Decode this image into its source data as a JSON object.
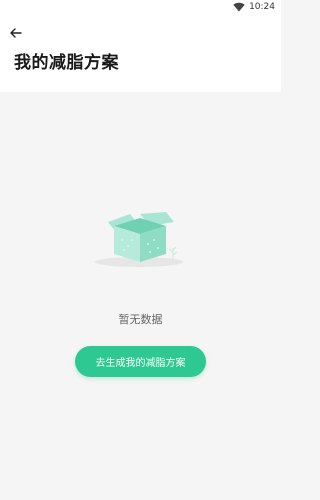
{
  "status_bar": {
    "time": "10:24",
    "wifi_icon": "wifi-icon"
  },
  "header": {
    "back_icon": "arrow-left-icon",
    "title": "我的减脂方案"
  },
  "empty_state": {
    "illustration": "empty-box-icon",
    "message": "暂无数据",
    "button_label": "去生成我的减脂方案"
  },
  "colors": {
    "accent": "#2ec992",
    "illustration": "#8fdcc4",
    "background": "#f5f5f5"
  }
}
